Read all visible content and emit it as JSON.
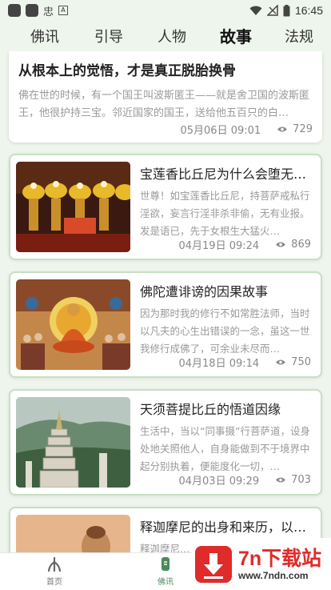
{
  "status_bar": {
    "left_icon_glyph": "忠",
    "left_icon_small": "A",
    "time": "16:45"
  },
  "tabs": [
    {
      "label": "佛讯",
      "active": false
    },
    {
      "label": "引导",
      "active": false
    },
    {
      "label": "人物",
      "active": false
    },
    {
      "label": "故事",
      "active": true
    },
    {
      "label": "法规",
      "active": false
    }
  ],
  "featured": {
    "title": "从根本上的觉悟，才是真正脱胎换骨",
    "excerpt": "佛在世的时候，有一个国王叫波斯匿王——就是舍卫国的波斯匿王，他很护持三宝。邻近国家的国王，送给他五百只的白…",
    "date": "05月06日 09:01",
    "views": "729"
  },
  "articles": [
    {
      "title": "宝莲香比丘尼为什么会堕无…",
      "excerpt": "世尊！如宝莲香比丘尼，持菩萨戒私行淫欲，妄言行淫非杀非偷，无有业报。发是语已，先于女根生大猛火…",
      "date": "04月19日 09:24",
      "views": "869",
      "image": "butter-lamps"
    },
    {
      "title": "佛陀遭诽谤的因果故事",
      "excerpt": "因为那时我的修行不如常胜法师，当时以凡夫的心生出错误的一念，虽这一世我修行成佛了，可余业未尽而…",
      "date": "04月18日 09:14",
      "views": "750",
      "image": "buddha-painting"
    },
    {
      "title": "天须菩提比丘的悟道因缘",
      "excerpt": "生活中，当以“同事摄”行菩萨道，设身处地关照他人，自身能做到不于境界中起分别执着，便能度化一切，…",
      "date": "04月03日 09:29",
      "views": "703",
      "image": "pagoda"
    },
    {
      "title": "释迦摩尼的出身和来历，以…",
      "excerpt": "释迦摩尼…",
      "image": "buddha-statue"
    }
  ],
  "bottom_nav": [
    {
      "label": "首页",
      "icon": "home-icon",
      "active": false
    },
    {
      "label": "佛讯",
      "icon": "news-icon",
      "active": true
    }
  ],
  "watermark": {
    "brand": "7n下载站",
    "url": "www.7ndn.com"
  },
  "colors": {
    "accent": "#4a8a5c",
    "card_border": "#c8dfc4",
    "background": "#eef5ec",
    "watermark_red": "#e02b2b"
  }
}
